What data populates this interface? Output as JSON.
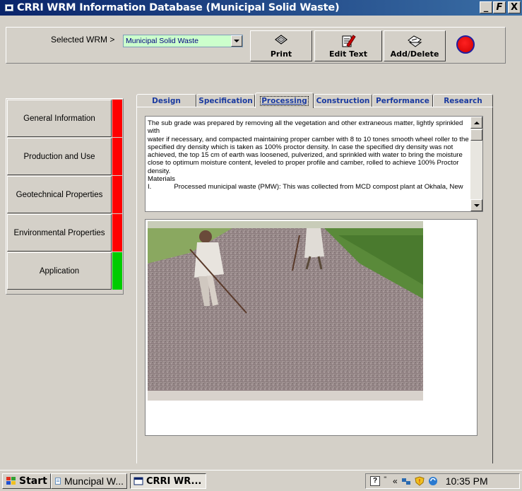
{
  "window": {
    "title": "CRRI WRM Information Database (Municipal Solid Waste)"
  },
  "window_controls": {
    "minimize": "_",
    "maximize": "̅F",
    "close": "X"
  },
  "toolbar": {
    "wrm_label": "Selected  WRM >",
    "wrm_value": "Municipal Solid Waste",
    "print_label": "Print",
    "edit_label": "Edit Text",
    "add_label": "Add/Delete",
    "record_color": "#ff0000"
  },
  "sidebar": {
    "items": [
      {
        "label": "General Information",
        "status_color": "#ff0000"
      },
      {
        "label": "Production and Use",
        "status_color": "#ff0000"
      },
      {
        "label": "Geotechnical Properties",
        "status_color": "#ff0000"
      },
      {
        "label": "Environmental Properties",
        "status_color": "#ff0000"
      },
      {
        "label": "Application",
        "status_color": "#00cc00"
      }
    ]
  },
  "tabs": {
    "items": [
      {
        "label": "Design"
      },
      {
        "label": "Specification"
      },
      {
        "label": "Processing"
      },
      {
        "label": "Construction"
      },
      {
        "label": "Performance"
      },
      {
        "label": "Research"
      }
    ],
    "active": "Processing"
  },
  "content": {
    "text": "The sub grade was prepared by removing all the vegetation and other extraneous matter, lightly sprinkled\nwith\nwater if necessary, and compacted maintaining proper camber with 8 to 10 tones smooth wheel roller to the\nspecified dry density which is taken as 100% proctor density. In case the specified dry density was not\nachieved, the top 15 cm of earth was loosened, pulverized, and sprinkled with water to bring the moisture\nclose to optimum moisture content, leveled to proper profile and camber, rolled to achieve 100% Proctor\ndensity.\nMaterials\nI.            Processed municipal waste (PMW): This was collected from MCD compost plant at Okhala, New"
  },
  "taskbar": {
    "start_label": "Start",
    "task1_label": "Muncipal W...",
    "task2_label": "CRRI WR...",
    "clock": "10:35 PM",
    "tray_help": "?",
    "tray_chevron": "«"
  }
}
